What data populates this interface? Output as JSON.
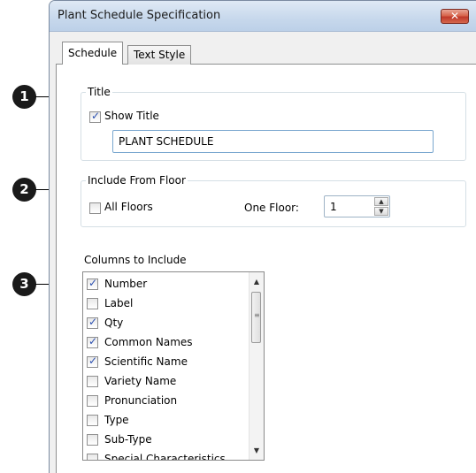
{
  "dialog": {
    "title": "Plant Schedule Specification",
    "close_glyph": "✕"
  },
  "tabs": [
    {
      "label": "Schedule",
      "active": true
    },
    {
      "label": "Text Style",
      "active": false
    }
  ],
  "title_group": {
    "label": "Title",
    "show_title_label": "Show Title",
    "show_title_checked": true,
    "title_value": "PLANT SCHEDULE"
  },
  "floor_group": {
    "label": "Include From Floor",
    "all_floors_label": "All Floors",
    "all_floors_checked": false,
    "one_floor_label": "One Floor:",
    "one_floor_value": "1"
  },
  "columns": {
    "label": "Columns to Include",
    "items": [
      {
        "label": "Number",
        "checked": true
      },
      {
        "label": "Label",
        "checked": false
      },
      {
        "label": "Qty",
        "checked": true
      },
      {
        "label": "Common Names",
        "checked": true
      },
      {
        "label": "Scientific Name",
        "checked": true
      },
      {
        "label": "Variety Name",
        "checked": false
      },
      {
        "label": "Pronunciation",
        "checked": false
      },
      {
        "label": "Type",
        "checked": false
      },
      {
        "label": "Sub-Type",
        "checked": false
      },
      {
        "label": "Special Characteristics",
        "checked": false
      }
    ]
  },
  "callouts": [
    "1",
    "2",
    "3"
  ],
  "icons": {
    "close": "close-icon",
    "spin_up": "spin-up-icon",
    "spin_down": "spin-down-icon",
    "scroll_up": "scroll-up-icon",
    "scroll_down": "scroll-down-icon"
  }
}
